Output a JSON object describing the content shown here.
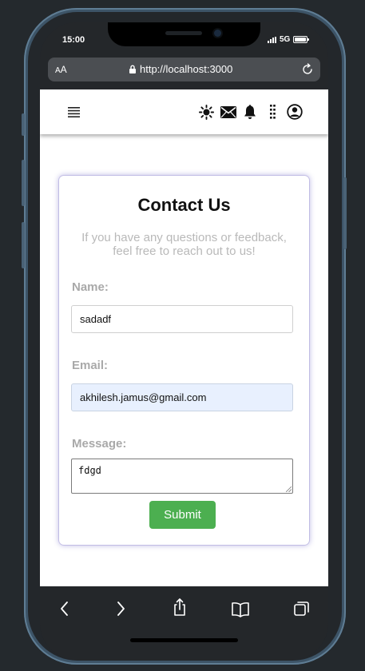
{
  "status_bar": {
    "time": "15:00",
    "network": "5G"
  },
  "browser": {
    "text_size_small": "A",
    "text_size_large": "A",
    "url": "http://localhost:3000"
  },
  "navbar": {
    "icons": [
      "menu-icon",
      "sun-icon",
      "mail-icon",
      "bell-icon",
      "dots-vertical-icon",
      "user-icon"
    ]
  },
  "contact": {
    "title": "Contact Us",
    "subtitle": "If you have any questions or feedback, feel free to reach out to us!",
    "name_label": "Name:",
    "name_value": "sadadf",
    "email_label": "Email:",
    "email_value": "akhilesh.jamus@gmail.com",
    "message_label": "Message:",
    "message_value": "fdgd",
    "submit_label": "Submit"
  },
  "colors": {
    "accent": "#4caf50",
    "autofill": "#e8f0fe",
    "label": "#a9a9a9"
  },
  "toolbar": {
    "icons": [
      "back-icon",
      "forward-icon",
      "share-icon",
      "bookmarks-icon",
      "tabs-icon"
    ]
  }
}
